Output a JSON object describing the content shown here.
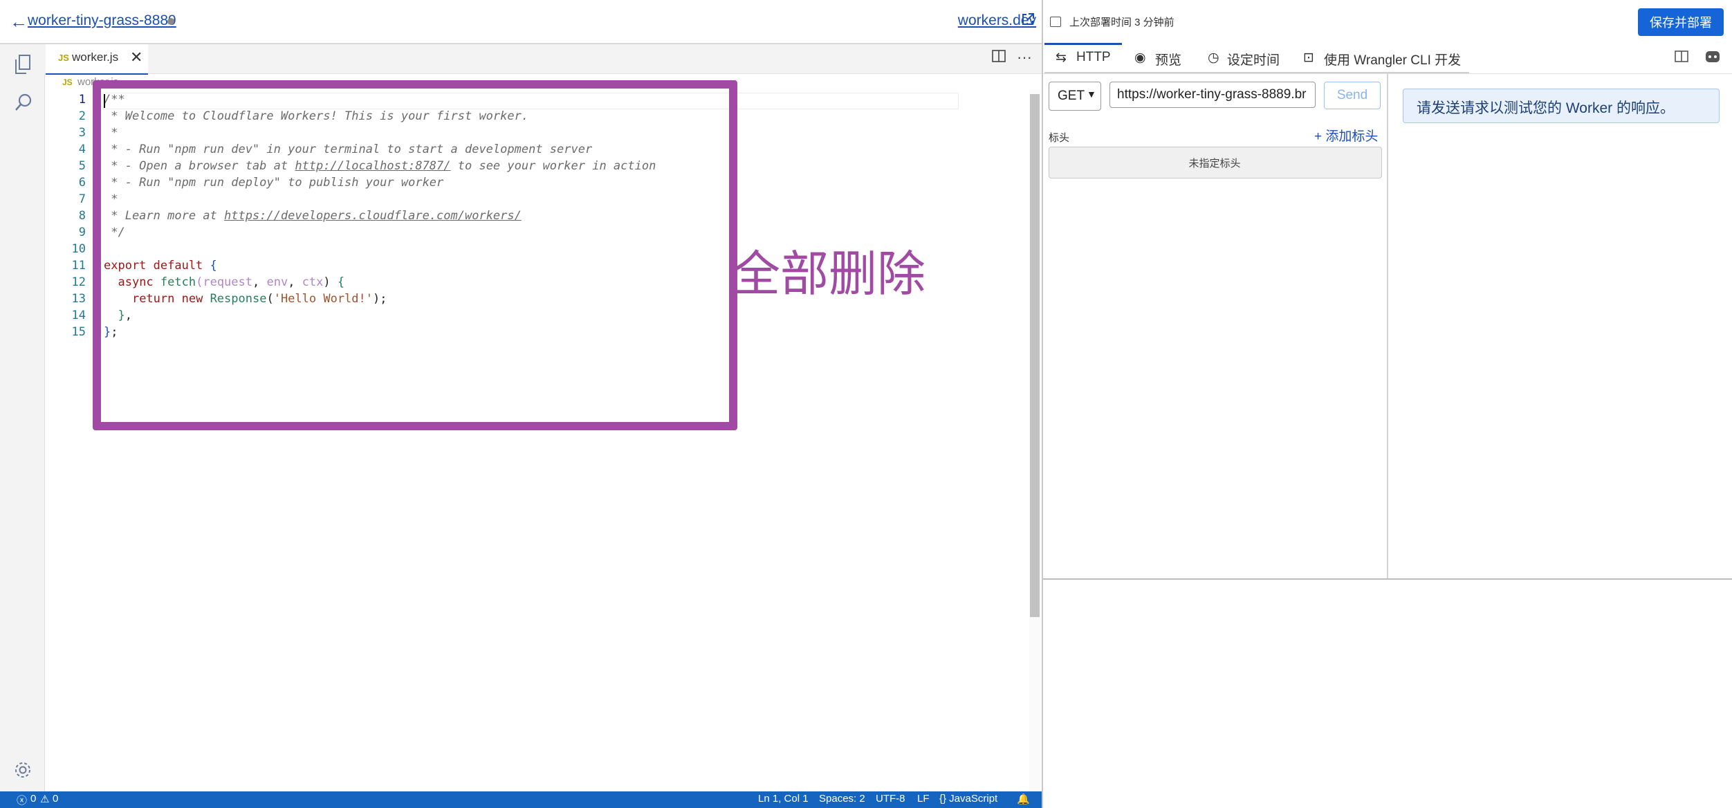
{
  "header": {
    "project_name": "worker-tiny-grass-8889",
    "workers_dev_link": "workers.dev"
  },
  "editor": {
    "tab_filename": "worker.js",
    "breadcrumb": "worker.js",
    "file_icon_label": "JS",
    "line_numbers": [
      "1",
      "2",
      "3",
      "4",
      "5",
      "6",
      "7",
      "8",
      "9",
      "10",
      "11",
      "12",
      "13",
      "14",
      "15"
    ]
  },
  "annotation": {
    "text": "全部删除",
    "color": "#a04aa3"
  },
  "status_bar": {
    "errors": "0",
    "warnings": "0",
    "position": "Ln 1, Col 1",
    "spaces": "Spaces: 2",
    "encoding": "UTF-8",
    "eol": "LF",
    "language": "{} JavaScript"
  },
  "right_panel": {
    "last_deploy": "上次部署时间 3 分钟前",
    "save_deploy_button": "保存并部署",
    "tabs": {
      "http": "HTTP",
      "preview": "预览",
      "schedule": "设定时间",
      "wrangler": "使用 Wrangler CLI 开发"
    },
    "method": "GET",
    "url": "https://worker-tiny-grass-8889.br",
    "send_button": "Send",
    "headers_label": "标头",
    "add_header": "添加标头",
    "no_headers": "未指定标头",
    "response_hint": "请发送请求以测试您的 Worker 的响应。"
  },
  "colors": {
    "accent": "#1565d8",
    "status_bar_bg": "#1565c0",
    "annotation": "#a04aa3"
  }
}
